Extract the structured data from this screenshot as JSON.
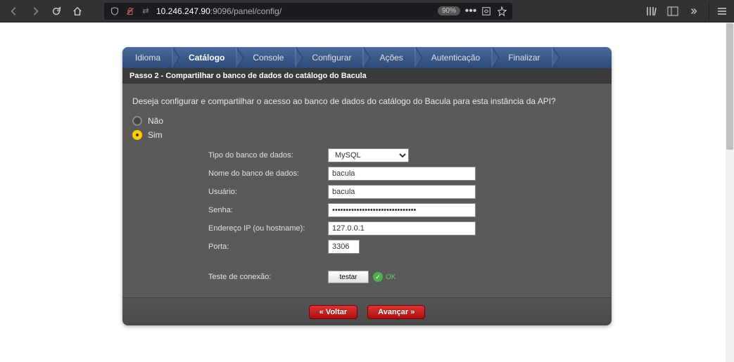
{
  "browser": {
    "url_prefix": "10.246.247.90",
    "url_suffix": ":9096/panel/config/",
    "zoom": "90%"
  },
  "steps": {
    "idioma": "Idioma",
    "catalogo": "Catálogo",
    "console": "Console",
    "configurar": "Configurar",
    "acoes": "Ações",
    "autenticacao": "Autenticação",
    "finalizar": "Finalizar"
  },
  "step_header": "Passo 2 - Compartilhar o banco de dados do catálogo do Bacula",
  "question": "Deseja configurar e compartilhar o acesso ao banco de dados do catálogo do Bacula para esta instância da API?",
  "radio": {
    "no": "Não",
    "yes": "Sim"
  },
  "form": {
    "labels": {
      "db_type": "Tipo do banco de dados:",
      "db_name": "Nome do banco de dados:",
      "user": "Usuário:",
      "password": "Senha:",
      "host": "Endereço IP (ou hostname):",
      "port": "Porta:",
      "test": "Teste de conexão:"
    },
    "values": {
      "db_type": "MySQL",
      "db_name": "bacula",
      "user": "bacula",
      "password": "•••••••••••••••••••••••••••••••",
      "host": "127.0.0.1",
      "port": "3306"
    },
    "test_button": "testar",
    "ok_label": "OK"
  },
  "footer": {
    "back": "« Voltar",
    "next": "Avançar »"
  }
}
